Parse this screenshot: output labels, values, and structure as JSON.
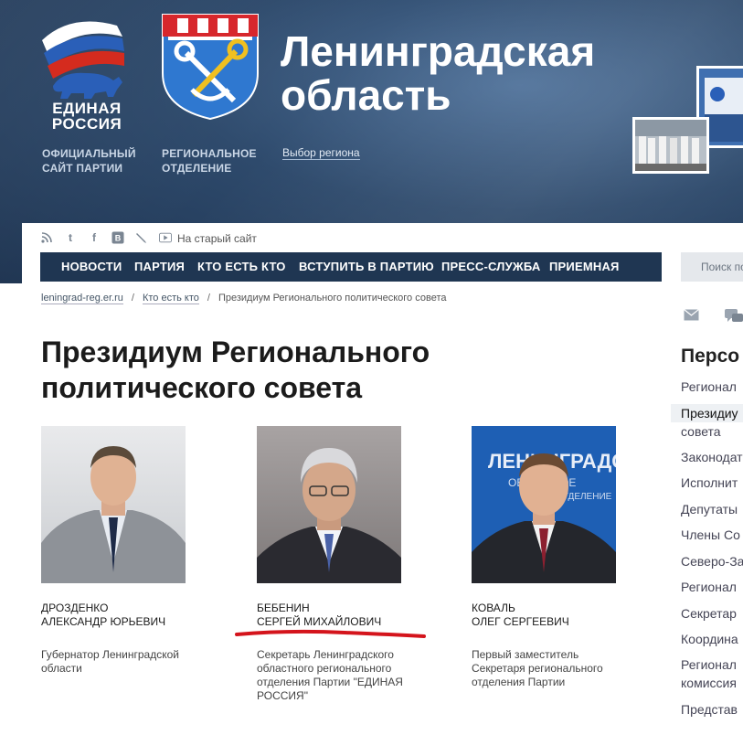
{
  "header": {
    "brand_line1": "ЕДИНАЯ",
    "brand_line2": "РОССИЯ",
    "caption_official_l1": "ОФИЦИАЛЬНЫЙ",
    "caption_official_l2": "САЙТ ПАРТИИ",
    "caption_regional_l1": "РЕГИОНАЛЬНОЕ",
    "caption_regional_l2": "ОТДЕЛЕНИЕ",
    "region_select": "Выбор региона",
    "region_name_l1": "Ленинградская",
    "region_name_l2": "область"
  },
  "toolbar": {
    "socials": [
      "rss-icon",
      "twitter-icon",
      "facebook-icon",
      "vk-icon",
      "livejournal-icon",
      "youtube-icon"
    ],
    "old_site": "На старый сайт"
  },
  "nav": {
    "items": [
      "НОВОСТИ",
      "ПАРТИЯ",
      "КТО ЕСТЬ КТО",
      "ВСТУПИТЬ В ПАРТИЮ",
      "ПРЕСС-СЛУЖБА",
      "ПРИЕМНАЯ"
    ],
    "search_placeholder": "Поиск по"
  },
  "breadcrumb": {
    "home": "leningrad-reg.er.ru",
    "section": "Кто есть кто",
    "current": "Президиум Регионального политического совета",
    "separator": "/"
  },
  "page": {
    "title_l1": "Президиум Регионального",
    "title_l2": "политического совета"
  },
  "people": [
    {
      "surname": "ДРОЗДЕНКО",
      "name": "АЛЕКСАНДР ЮРЬЕВИЧ",
      "position_l1": "Губернатор Ленинградской",
      "position_l2": "области",
      "position_l3": "",
      "position_l4": ""
    },
    {
      "surname": "БЕБЕНИН",
      "name": "СЕРГЕЙ МИХАЙЛОВИЧ",
      "position_l1": "Секретарь Ленинградского",
      "position_l2": "областного регионального",
      "position_l3": "отделения Партии \"ЕДИНАЯ",
      "position_l4": "РОССИЯ\""
    },
    {
      "surname": "КОВАЛЬ",
      "name": "ОЛЕГ СЕРГЕЕВИЧ",
      "position_l1": "Первый заместитель",
      "position_l2": "Секретаря регионального",
      "position_l3": "отделения Партии",
      "position_l4": ""
    }
  ],
  "photo3_banner": {
    "line1": "ЛЕНИНГРАДСКО",
    "line2": "ОБЛАСТНОЕ",
    "line3": "ОТДЕЛЕНИЕ"
  },
  "sidebar": {
    "title": "Персо",
    "items": [
      "Регионал",
      "Президиу",
      "совета",
      "Законодат",
      "Исполнит",
      "Депутаты",
      "Члены Со",
      "Северо-За",
      "Регионал",
      "Секретар",
      "Координа",
      "Регионал",
      "комиссия",
      "Представ"
    ]
  },
  "colors": {
    "header_bg": "#2e4a6c",
    "nav_bg": "#1f3652",
    "annotation_red": "#d4141c"
  }
}
